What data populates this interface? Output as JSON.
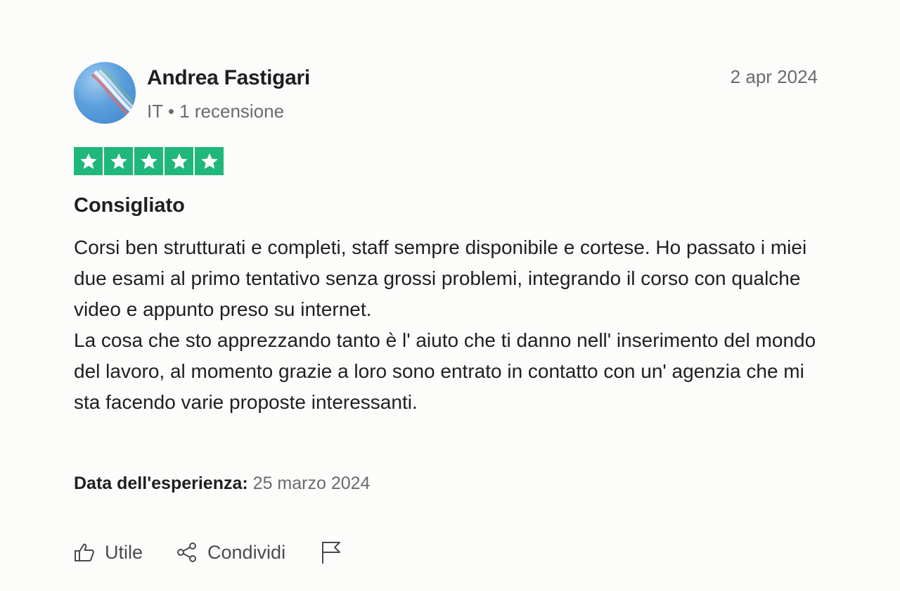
{
  "author": {
    "name": "Andrea Fastigari",
    "meta": "IT • 1 recensione"
  },
  "review": {
    "date": "2 apr 2024",
    "rating": 5,
    "star_color": "#1fb77a",
    "title": "Consigliato",
    "body_lines": [
      "Corsi ben strutturati e completi, staff sempre disponibile e cortese. Ho passato i miei due esami al primo tentativo senza grossi problemi, integrando il corso con qualche video e appunto preso su internet.",
      "La cosa che sto apprezzando tanto è l' aiuto che ti danno nell' inserimento del mondo del lavoro, al momento grazie a loro sono entrato in contatto con un' agenzia che mi sta facendo varie proposte interessanti."
    ],
    "experience_label": "Data dell'esperienza:",
    "experience_date": "25 marzo 2024"
  },
  "actions": {
    "useful_label": "Utile",
    "share_label": "Condividi"
  },
  "icons": [
    "thumbs-up-icon",
    "share-icon",
    "flag-icon",
    "star-icon"
  ]
}
